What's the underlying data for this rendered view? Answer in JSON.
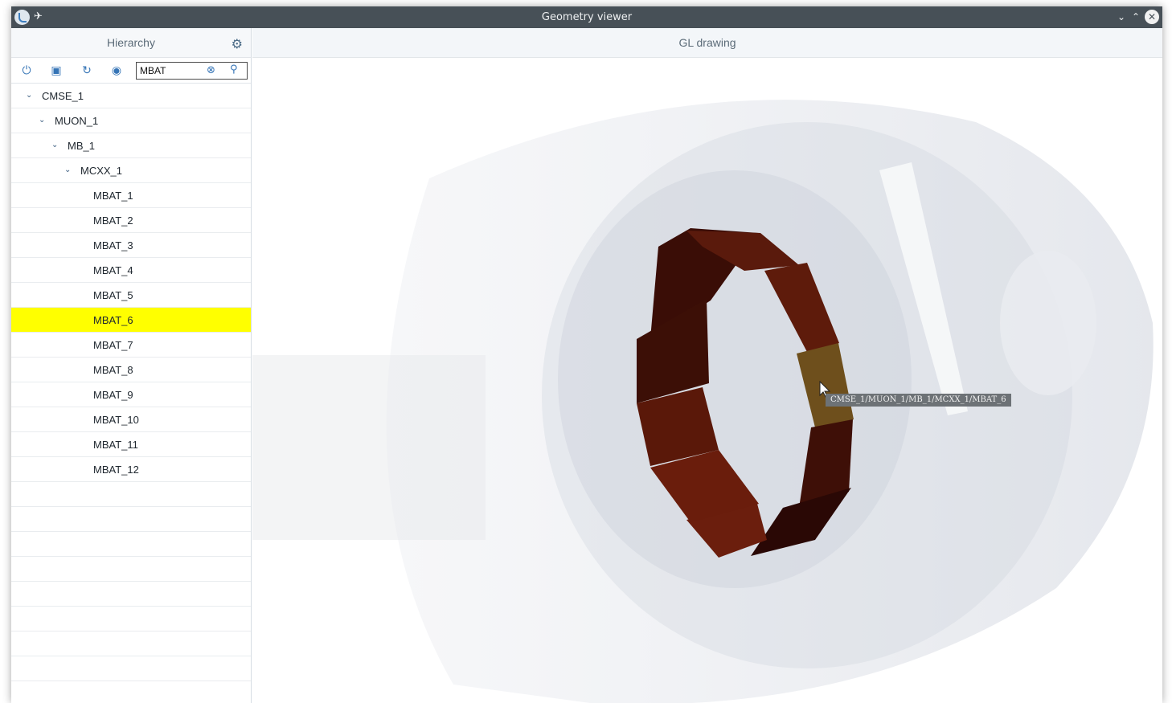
{
  "window": {
    "title": "Geometry viewer"
  },
  "titlebar_icons": [
    "app-icon",
    "pin-icon",
    "minimize-icon",
    "maximize-icon",
    "close-icon"
  ],
  "hierarchy": {
    "title": "Hierarchy",
    "toolbar_icons": [
      "power-icon",
      "save-icon",
      "refresh-icon",
      "eye-icon",
      "search-clear-icon",
      "search-icon"
    ],
    "search": {
      "value": "MBAT",
      "placeholder": ""
    },
    "tree": [
      {
        "label": "CMSE_1",
        "expanded": true
      },
      {
        "label": "MUON_1",
        "expanded": true
      },
      {
        "label": "MB_1",
        "expanded": true
      },
      {
        "label": "MCXX_1",
        "expanded": true
      },
      {
        "label": "MBAT_1"
      },
      {
        "label": "MBAT_2"
      },
      {
        "label": "MBAT_3"
      },
      {
        "label": "MBAT_4"
      },
      {
        "label": "MBAT_5"
      },
      {
        "label": "MBAT_6",
        "selected": true
      },
      {
        "label": "MBAT_7"
      },
      {
        "label": "MBAT_8"
      },
      {
        "label": "MBAT_9"
      },
      {
        "label": "MBAT_10"
      },
      {
        "label": "MBAT_11"
      },
      {
        "label": "MBAT_12"
      }
    ]
  },
  "gl": {
    "title": "GL drawing",
    "tooltip": "CMSE_1/MUON_1/MB_1/MCXX_1/MBAT_6"
  },
  "colors": {
    "titlebar": "#475057",
    "selection": "#ffff00",
    "accent": "#3574b6",
    "ring": "#7a2210",
    "highlight": "#6e4f1c"
  }
}
